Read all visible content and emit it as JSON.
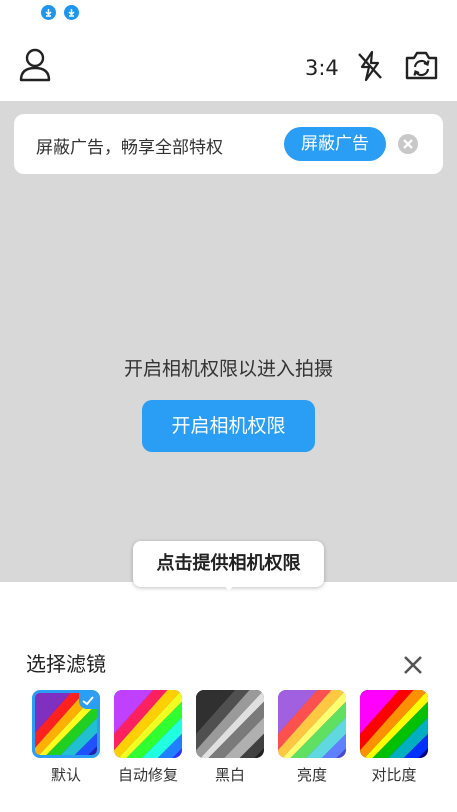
{
  "status_bar": {
    "icons": [
      "download-icon",
      "download-icon"
    ]
  },
  "top_bar": {
    "profile_icon": "user-icon",
    "aspect_ratio": "3:4",
    "flash_icon": "flash-off-icon",
    "switch_icon": "camera-switch-icon"
  },
  "ad_banner": {
    "text": "屏蔽广告，畅享全部特权",
    "button_label": "屏蔽广告",
    "close_icon": "close-circle-icon"
  },
  "permission": {
    "message": "开启相机权限以进入拍摄",
    "button_label": "开启相机权限"
  },
  "tooltip": {
    "text": "点击提供相机权限"
  },
  "filter_panel": {
    "title": "选择滤镜",
    "close_icon": "close-icon",
    "items": [
      {
        "label": "默认",
        "selected": true
      },
      {
        "label": "自动修复",
        "selected": false
      },
      {
        "label": "黑白",
        "selected": false
      },
      {
        "label": "亮度",
        "selected": false
      },
      {
        "label": "对比度",
        "selected": false
      }
    ]
  },
  "colors": {
    "accent": "#2a9df4",
    "preview_bg": "#d8d8d8"
  }
}
